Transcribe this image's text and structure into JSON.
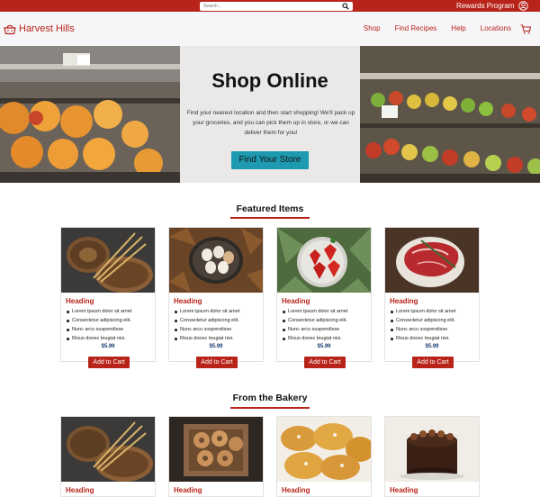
{
  "topbar": {
    "search_placeholder": "Search...",
    "rewards_label": "Rewards Program",
    "icons": {
      "search": "search-icon",
      "user": "user-circle-icon"
    }
  },
  "brand": {
    "name": "Harvest Hills",
    "icon": "basket-icon"
  },
  "nav": {
    "links": [
      "Shop",
      "Find Recipes",
      "Help",
      "Locations"
    ],
    "cart_icon": "cart-icon"
  },
  "hero": {
    "title": "Shop Online",
    "text": "Find your nearest location and then start shopping! We'll pack up your groceries, and you can pick them up in store, or we can deliver them for you!",
    "button": "Find Your Store"
  },
  "featured": {
    "title": "Featured Items",
    "items": [
      {
        "image": "bread-loaves-with-wheat",
        "heading": "Heading",
        "bullets": [
          "Lorem ipsum dolor sit amet",
          "Consectetur adipiscing elit.",
          "Nunc arcu suspendisse",
          "Risus donec teugiat nisi."
        ],
        "price": "$5.99",
        "button": "Add to Cart"
      },
      {
        "image": "eggs-in-basket-on-leaves",
        "heading": "Heading",
        "bullets": [
          "Lorem ipsum dolor sit amet",
          "Consectetur adipiscing elit.",
          "Nunc arcu suspendisse",
          "Risus donec teugiat nisi."
        ],
        "price": "$5.99",
        "button": "Add to Cart"
      },
      {
        "image": "strawberries-in-bowl",
        "heading": "Heading",
        "bullets": [
          "Lorem ipsum dolor sit amet",
          "Consectetur adipiscing elit.",
          "Nunc arcu suspendisse",
          "Risus donec teugiat nisi."
        ],
        "price": "$5.99",
        "button": "Add to Cart"
      },
      {
        "image": "raw-steak-with-rosemary",
        "heading": "Heading",
        "bullets": [
          "Lorem ipsum dolor sit amet",
          "Consectetur adipiscing elit.",
          "Nunc arcu suspendisse",
          "Risus donec teugiat nisi."
        ],
        "price": "$5.99",
        "button": "Add to Cart"
      }
    ]
  },
  "bakery": {
    "title": "From the Bakery",
    "items": [
      {
        "image": "bread-loaves-with-wheat",
        "heading": "Heading"
      },
      {
        "image": "donuts-in-crate",
        "heading": "Heading"
      },
      {
        "image": "pastries",
        "heading": "Heading"
      },
      {
        "image": "chocolate-cake",
        "heading": "Heading"
      }
    ]
  },
  "colors": {
    "brand_red": "#b8241a",
    "button_teal": "#1e9ab0",
    "price_navy": "#1a3a6e",
    "nav_bg": "#f6f6f8"
  }
}
